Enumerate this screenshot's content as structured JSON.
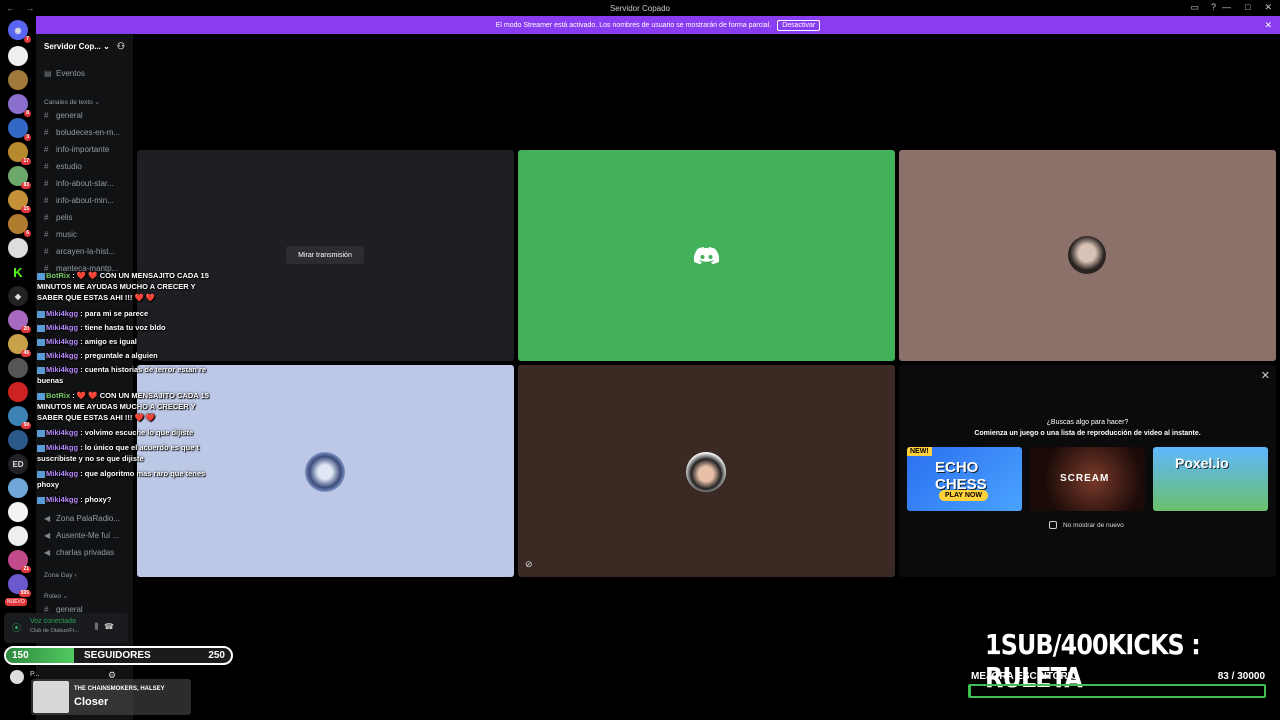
{
  "window": {
    "title": "Servidor Copado"
  },
  "streamer_banner": {
    "text": "El modo Streamer está activado. Los nombres de usuario se mostrarán de forma parcial.",
    "button": "Desactivar"
  },
  "server": {
    "name": "Servidor Cop...",
    "events": "Eventos"
  },
  "categories": {
    "text": "Canales de texto",
    "zona": "Zona Gay",
    "roleo": "Roleo"
  },
  "channels": [
    "general",
    "boludeces-en-m...",
    "info-importante",
    "estudio",
    "info-about-star...",
    "info-about-min...",
    "pelis",
    "music",
    "arcayen-la-hist...",
    "manteca-mantp..."
  ],
  "voice_channels": [
    "Zona PalaRadio...",
    "Ausente-Me fuí ...",
    "charlas privadas"
  ],
  "roleo_channel": "general",
  "rail_badges": [
    "7",
    "8",
    "3",
    "17",
    "83",
    "15",
    "6",
    "20",
    "45",
    "50",
    "21",
    "595"
  ],
  "rail_nuevo": "NUEVO",
  "rail_ed": "ED",
  "voice_panel": {
    "status": "Voz conectada",
    "channel": "Club de Otakus/Fr..."
  },
  "stream": {
    "watch_button": "Mirar transmisión"
  },
  "activity_panel": {
    "question": "¿Buscas algo para hacer?",
    "subtitle": "Comienza un juego o una lista de reproducción de video al instante.",
    "games": [
      {
        "name": "ECHO CHESS",
        "badge": "NEW!",
        "cta": "PLAY NOW"
      },
      {
        "name": "SCREAM"
      },
      {
        "name": "Poxel.io"
      }
    ],
    "checkbox": "No mostrar de nuevo"
  },
  "chat": [
    {
      "user": "BotRix",
      "text": ": ❤️ ❤️ CON UN MENSAJITO CADA 15 MINUTOS ME AYUDAS MUCHO A CRECER Y SABER QUE ESTAS AHI !!! ❤️ ❤️"
    },
    {
      "user": "Miki4kgg",
      "text": ": para mi se parece"
    },
    {
      "user": "Miki4kgg",
      "text": ": tiene hasta tu voz bldo"
    },
    {
      "user": "Miki4kgg",
      "text": ": amigo es igual"
    },
    {
      "user": "Miki4kgg",
      "text": ": preguntale a alguien"
    },
    {
      "user": "Miki4kgg",
      "text": ": cuenta historias de terror estan re buenas"
    },
    {
      "user": "BotRix",
      "text": ": ❤️ ❤️ CON UN MENSAJITO CADA 15 MINUTOS ME AYUDAS MUCHO A CRECER Y SABER QUE ESTAS AHI !!! ❤️ ❤️"
    },
    {
      "user": "Miki4kgg",
      "text": ": volvimo escuche lo que dijiste"
    },
    {
      "user": "Miki4kgg",
      "text": ": lo único que el acuerdo es que t suscribiste y no se que dijiste"
    },
    {
      "user": "Miki4kgg",
      "text": ": que algoritmo mas raro que tenes phoxy"
    },
    {
      "user": "Miki4kgg",
      "text": ": phoxy?"
    }
  ],
  "followers": {
    "start": "150",
    "label": "SEGUIDORES",
    "goal": "250",
    "progress": 0.3
  },
  "now_playing": {
    "artist": "THE CHAINSMOKERS, HALSEY",
    "title": "Closer"
  },
  "overlay": {
    "headline": "1SUB/400KICKS : RULETA",
    "goal_label": "MEJORA ESCRITORIO",
    "goal_count": "83  / 30000",
    "goal_progress": 0.003
  },
  "user": {
    "name": "P..."
  }
}
